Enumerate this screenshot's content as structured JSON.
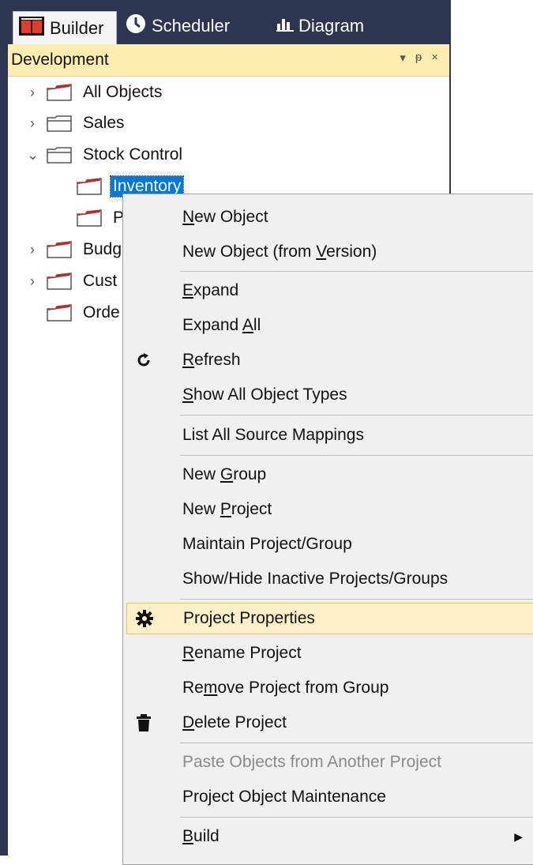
{
  "tabs": [
    {
      "label": "Builder",
      "icon": "builder-icon"
    },
    {
      "label": "Scheduler",
      "icon": "clock-icon"
    },
    {
      "label": "Diagram",
      "icon": "bar-chart-icon"
    }
  ],
  "panel": {
    "title": "Development",
    "controls": {
      "dropdown": "▾",
      "pin": "ᵽ",
      "close": "×"
    }
  },
  "tree": [
    {
      "label": "All Objects",
      "expanded": false,
      "icon": "red-folder-icon"
    },
    {
      "label": "Sales",
      "expanded": false,
      "icon": "folder-icon"
    },
    {
      "label": "Stock Control",
      "expanded": true,
      "icon": "folder-icon"
    },
    {
      "label": "Inventory",
      "selected": true,
      "icon": "red-folder-icon"
    },
    {
      "label": "P",
      "icon": "red-folder-icon"
    },
    {
      "label": "Budg",
      "expanded": false,
      "icon": "red-folder-icon"
    },
    {
      "label": "Cust",
      "expanded": false,
      "icon": "red-folder-icon"
    },
    {
      "label": "Orde",
      "icon": "red-folder-icon"
    }
  ],
  "menu": {
    "items": [
      {
        "pre": "",
        "u": "N",
        "post": "ew Object"
      },
      {
        "pre": "New Object (from ",
        "u": "V",
        "post": "ersion)"
      },
      {
        "pre": "",
        "u": "E",
        "post": "xpand"
      },
      {
        "pre": "Expand ",
        "u": "A",
        "post": "ll"
      },
      {
        "pre": "",
        "u": "R",
        "post": "efresh",
        "icon": "refresh-icon"
      },
      {
        "pre": "",
        "u": "S",
        "post": "how All Object Types"
      },
      {
        "pre": "List All Source Mappings",
        "u": "",
        "post": ""
      },
      {
        "pre": "New ",
        "u": "G",
        "post": "roup"
      },
      {
        "pre": "New ",
        "u": "P",
        "post": "roject"
      },
      {
        "pre": "Maintain Project/Group",
        "u": "",
        "post": ""
      },
      {
        "pre": "Show/Hide Inactive Projects/Groups",
        "u": "",
        "post": ""
      },
      {
        "pre": "Project Properties",
        "u": "",
        "post": "",
        "icon": "gear-icon",
        "highlighted": true
      },
      {
        "pre": "",
        "u": "R",
        "post": "ename Project"
      },
      {
        "pre": "Re",
        "u": "m",
        "post": "ove Project from Group"
      },
      {
        "pre": "",
        "u": "D",
        "post": "elete Project",
        "icon": "trash-icon"
      },
      {
        "pre": "Paste Objects from Another Project",
        "u": "",
        "post": "",
        "disabled": true
      },
      {
        "pre": "Project Object Maintenance",
        "u": "",
        "post": ""
      },
      {
        "pre": "",
        "u": "B",
        "post": "uild",
        "submenu": true
      }
    ]
  }
}
